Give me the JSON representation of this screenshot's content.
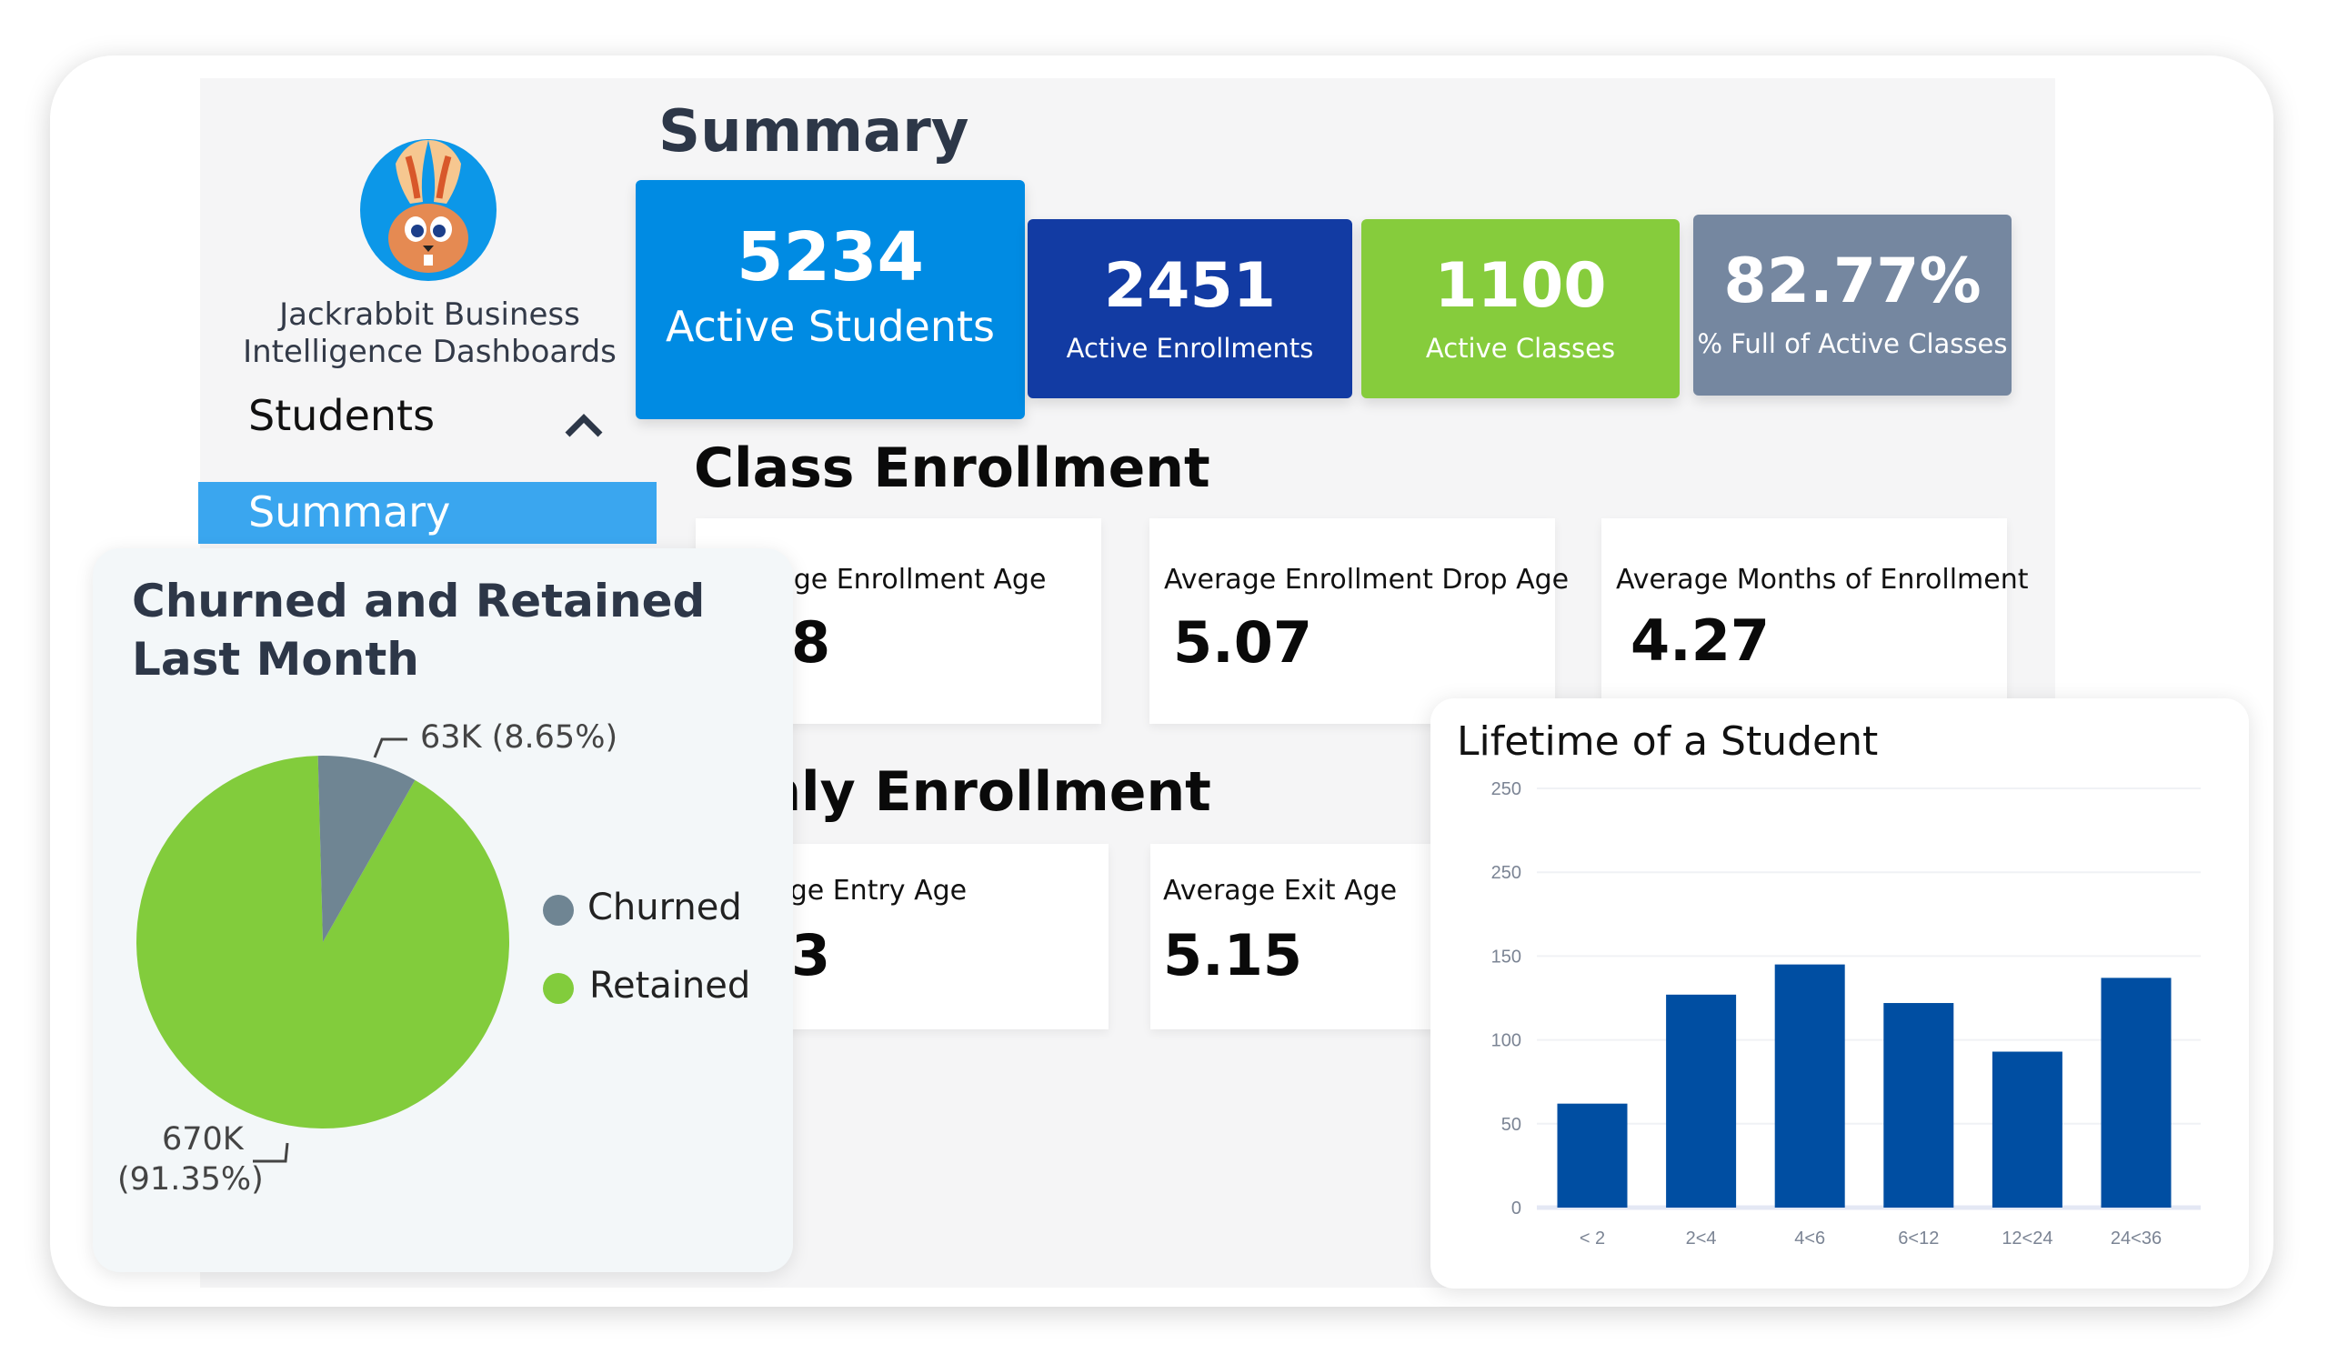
{
  "brand": {
    "line1": "Jackrabbit Business",
    "line2": "Intelligence Dashboards",
    "logo": "jackrabbit-rabbit-logo"
  },
  "nav": {
    "section": "Students",
    "section_icon": "chevron-up-icon",
    "active_item": "Summary"
  },
  "summary": {
    "title": "Summary",
    "kpis": [
      {
        "value": "5234",
        "label": "Active Students",
        "color": "#008be3"
      },
      {
        "value": "2451",
        "label": "Active Enrollments",
        "color": "#123ba3"
      },
      {
        "value": "1100",
        "label": "Active Classes",
        "color": "#86cc3c"
      },
      {
        "value": "82.77%",
        "label": "% Full of Active Classes",
        "color": "#7587a0"
      }
    ]
  },
  "class_enrollment": {
    "title": "Class Enrollment",
    "cards": [
      {
        "label": "Average Enrollment Age",
        "value": "8"
      },
      {
        "label": "Average Enrollment Drop Age",
        "value": "5.07"
      },
      {
        "label": "Average Months of Enrollment",
        "value": "4.27"
      }
    ]
  },
  "monthly_enrollment": {
    "title": "Monthly Enrollment",
    "cards": [
      {
        "label": "Average Entry Age",
        "value": "3"
      },
      {
        "label": "Average Exit Age",
        "value": "5.15"
      }
    ]
  },
  "chart_data": [
    {
      "type": "pie",
      "title": "Churned and Retained Last Month",
      "legend_position": "right",
      "slices": [
        {
          "name": "Churned",
          "value": 63000,
          "percent": 8.65,
          "label": "63K (8.65%)",
          "color": "#6f8593"
        },
        {
          "name": "Retained",
          "value": 670000,
          "percent": 91.35,
          "label_value": "670K",
          "label_percent": "(91.35%)",
          "color": "#82cc3c"
        }
      ]
    },
    {
      "type": "bar",
      "title": "Lifetime of a Student",
      "categories": [
        "< 2",
        "2<4",
        "4<6",
        "6<12",
        "12<24",
        "24<36"
      ],
      "values": [
        62,
        127,
        145,
        122,
        93,
        137
      ],
      "ytick_labels": [
        "0",
        "50",
        "100",
        "150",
        "250",
        "250"
      ],
      "ylim": [
        0,
        250
      ],
      "grid": true,
      "color": "#004ea2"
    }
  ]
}
